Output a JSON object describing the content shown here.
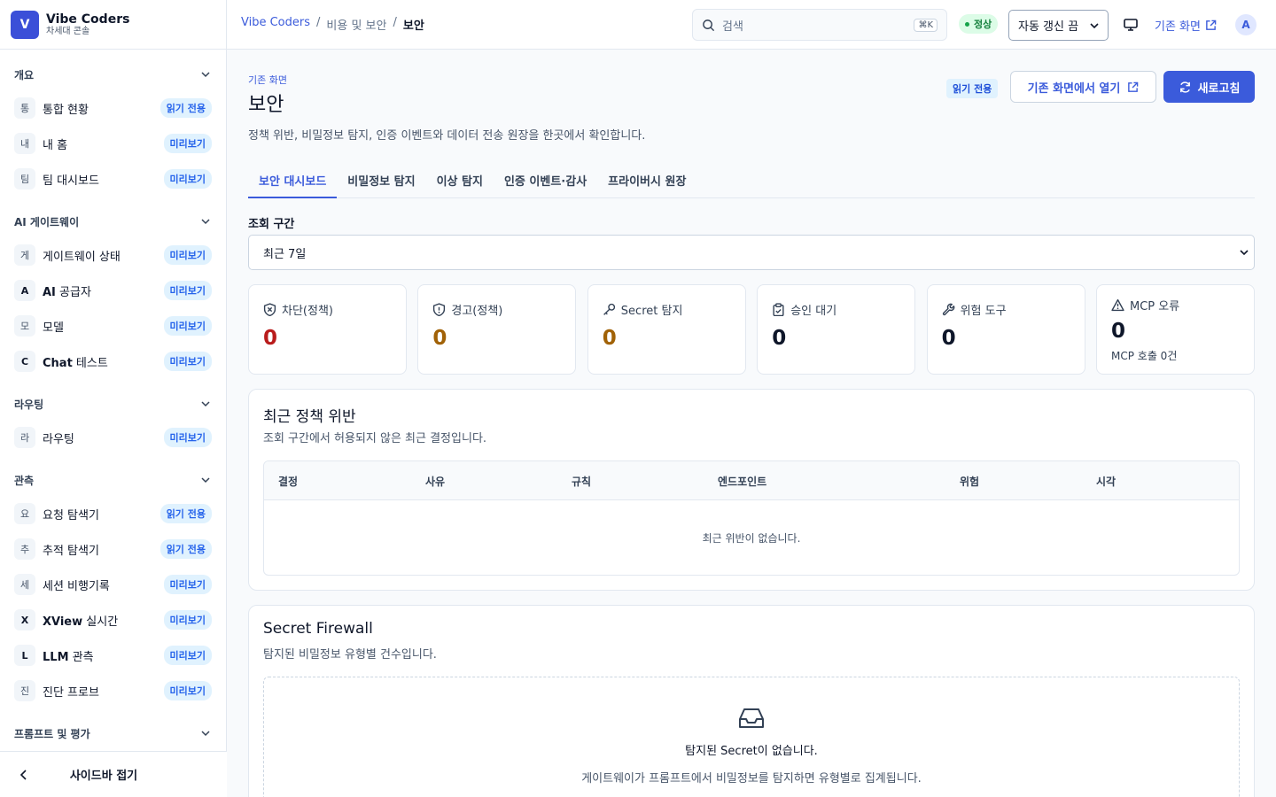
{
  "brand": {
    "initial": "V",
    "name": "Vibe Coders",
    "subtitle": "차세대 콘솔"
  },
  "sidebar": {
    "sections": [
      {
        "title": "개요",
        "items": [
          {
            "initial": "통",
            "label": "통합 현황",
            "badge": "읽기 전용"
          },
          {
            "initial": "내",
            "label": "내 홈",
            "badge": "미리보기"
          },
          {
            "initial": "팀",
            "label": "팀 대시보드",
            "badge": "미리보기"
          }
        ]
      },
      {
        "title": "AI 게이트웨이",
        "items": [
          {
            "initial": "게",
            "label": "게이트웨이 상태",
            "badge": "미리보기"
          },
          {
            "initial": "A",
            "label_strong": "AI",
            "label_rest": " 공급자",
            "badge": "미리보기"
          },
          {
            "initial": "모",
            "label": "모델",
            "badge": "미리보기"
          },
          {
            "initial": "C",
            "label_strong": "Chat",
            "label_rest": " 테스트",
            "badge": "미리보기"
          }
        ]
      },
      {
        "title": "라우팅",
        "items": [
          {
            "initial": "라",
            "label": "라우팅",
            "badge": "미리보기"
          }
        ]
      },
      {
        "title": "관측",
        "items": [
          {
            "initial": "요",
            "label": "요청 탐색기",
            "badge": "읽기 전용"
          },
          {
            "initial": "추",
            "label": "추적 탐색기",
            "badge": "읽기 전용"
          },
          {
            "initial": "세",
            "label": "세션 비행기록",
            "badge": "미리보기"
          },
          {
            "initial": "X",
            "label_strong": "XView",
            "label_rest": " 실시간",
            "badge": "미리보기"
          },
          {
            "initial": "L",
            "label_strong": "LLM",
            "label_rest": " 관측",
            "badge": "미리보기"
          },
          {
            "initial": "진",
            "label": "진단 프로브",
            "badge": "미리보기"
          }
        ]
      },
      {
        "title": "프롬프트 및 평가",
        "items": []
      }
    ],
    "collapse_label": "사이드바 접기"
  },
  "topbar": {
    "breadcrumb": [
      "Vibe Coders",
      "비용 및 보안",
      "보안"
    ],
    "search_placeholder": "검색",
    "search_shortcut": "⌘K",
    "status": "정상",
    "auto_refresh": "자동 갱신 끔",
    "legacy_link": "기존 화면",
    "avatar": "A"
  },
  "page": {
    "eyebrow": "기존 화면",
    "title": "보안",
    "description": "정책 위반, 비밀정보 탐지, 인증 이벤트와 데이터 전송 원장을 한곳에서 확인합니다.",
    "readonly_badge": "읽기 전용",
    "open_legacy_button": "기존 화면에서 열기",
    "refresh_button": "새로고침",
    "tabs": [
      "보안 대시보드",
      "비밀정보 탐지",
      "이상 탐지",
      "인증 이벤트·감사",
      "프라이버시 원장"
    ],
    "active_tab": 0,
    "range_label": "조회 구간",
    "range_value": "최근 7일"
  },
  "stats": [
    {
      "label": "차단(정책)",
      "value": "0",
      "color": "#b91c1c",
      "icon": "shield-x-icon"
    },
    {
      "label": "경고(정책)",
      "value": "0",
      "color": "#a16207",
      "icon": "shield-alert-icon"
    },
    {
      "label": "Secret 탐지",
      "value": "0",
      "color": "#a16207",
      "icon": "key-icon"
    },
    {
      "label": "승인 대기",
      "value": "0",
      "color": "#0f172a",
      "icon": "clipboard-icon"
    },
    {
      "label": "위험 도구",
      "value": "0",
      "color": "#0f172a",
      "icon": "wrench-icon"
    },
    {
      "label": "MCP 오류",
      "value": "0",
      "color": "#0f172a",
      "icon": "warning-icon",
      "sub": "MCP 호출 0건"
    }
  ],
  "violations": {
    "title": "최근 정책 위반",
    "description": "조회 구간에서 허용되지 않은 최근 결정입니다.",
    "columns": [
      "결정",
      "사유",
      "규칙",
      "엔드포인트",
      "위험",
      "시각"
    ],
    "empty": "최근 위반이 없습니다."
  },
  "firewall": {
    "title": "Secret Firewall",
    "description": "탐지된 비밀정보 유형별 건수입니다.",
    "empty_title": "탐지된 Secret이 없습니다.",
    "empty_desc": "게이트웨이가 프롬프트에서 비밀정보를 탐지하면 유형별로 집계됩니다."
  }
}
